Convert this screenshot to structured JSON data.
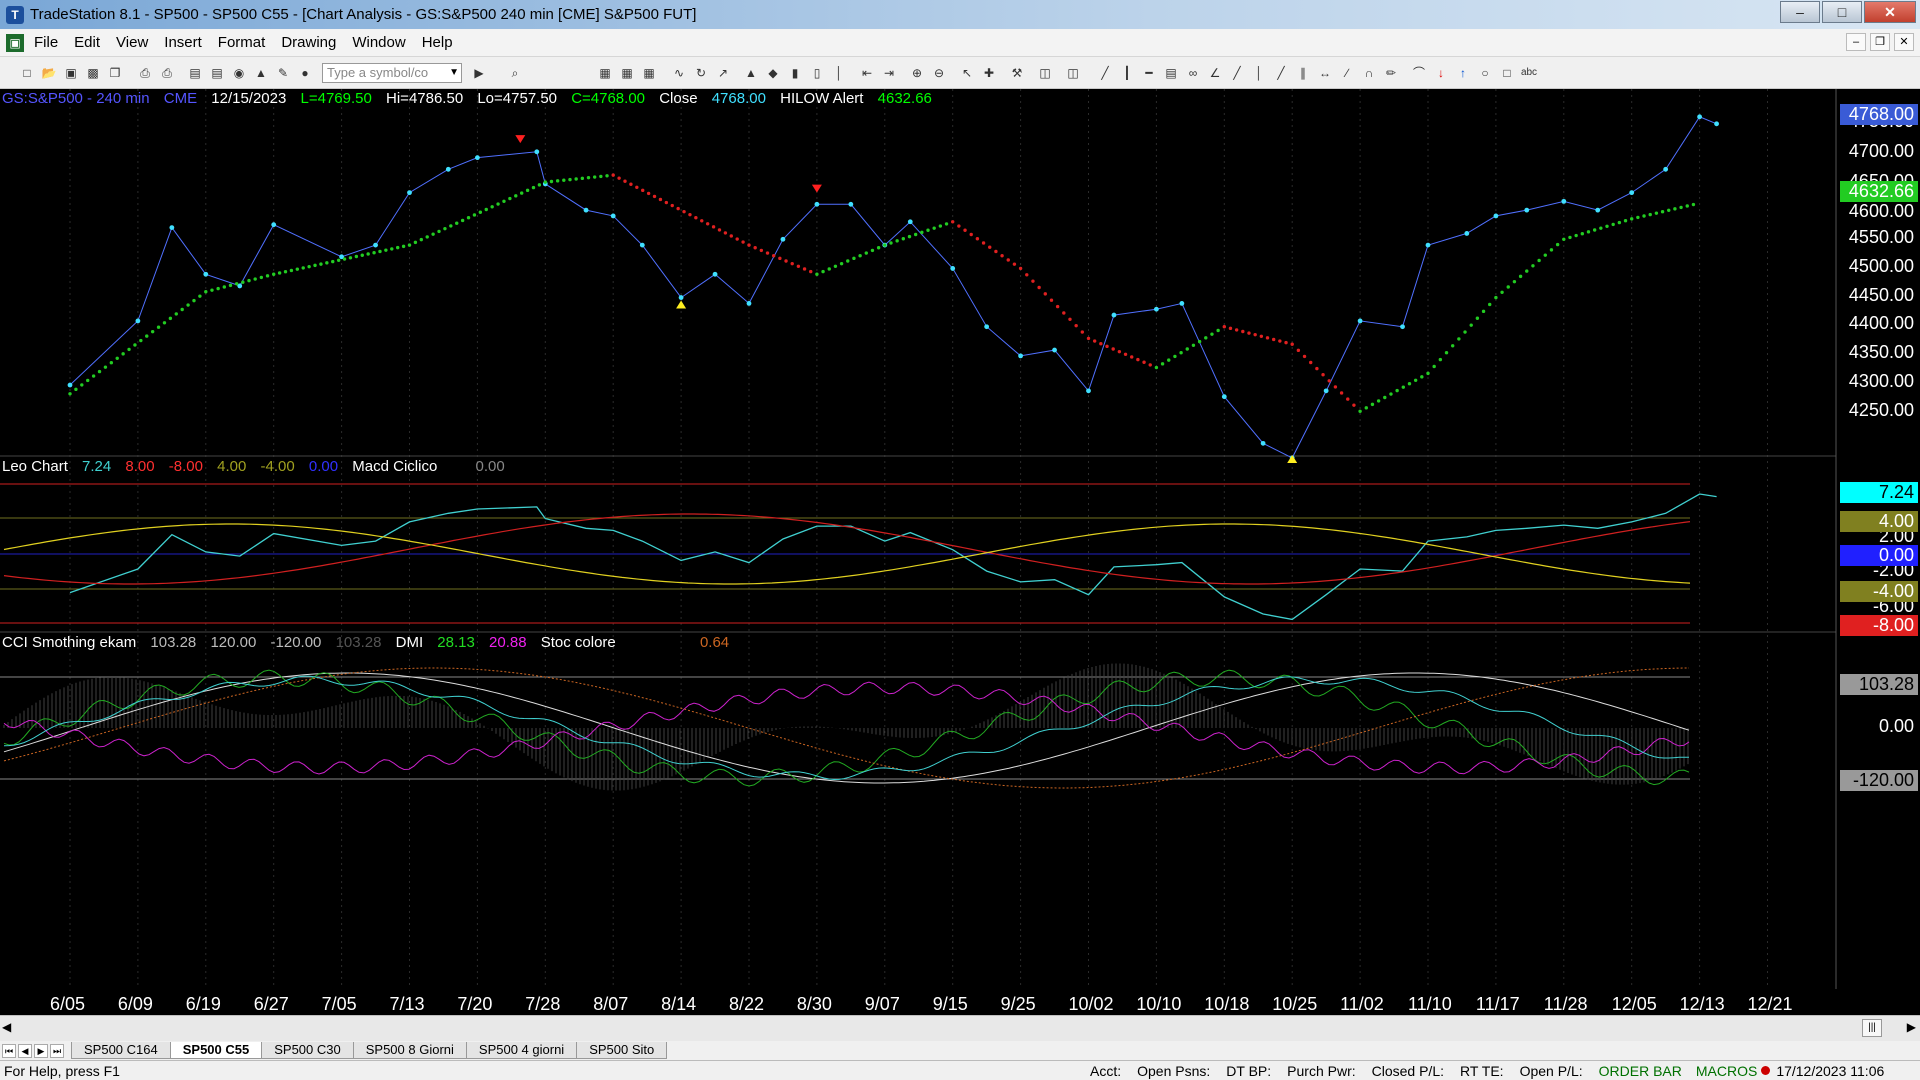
{
  "window": {
    "title": "TradeStation 8.1 - SP500 - SP500 C55 - [Chart Analysis - GS:S&P500  240 min  [CME] S&P500 FUT]"
  },
  "menu": [
    "File",
    "Edit",
    "View",
    "Insert",
    "Format",
    "Drawing",
    "Window",
    "Help"
  ],
  "toolbar": {
    "symbol_placeholder": "Type a symbol/co"
  },
  "price_panel": {
    "symbol": "GS:S&P500 - 240 min",
    "exchange": "CME",
    "date": "12/15/2023",
    "last": "L=4769.50",
    "high": "Hi=4786.50",
    "low": "Lo=4757.50",
    "close_c": "C=4768.00",
    "close_label": "Close",
    "close_value": "4768.00",
    "indicator": "HILOW Alert",
    "indicator_value": "4632.66",
    "axis_labels": [
      "4750.00",
      "4700.00",
      "4650.00",
      "4600.00",
      "4550.00",
      "4500.00",
      "4450.00",
      "4400.00",
      "4350.00",
      "4300.00",
      "4250.00"
    ],
    "last_price_tag": "4768.00",
    "hilow_tag": "4632.66"
  },
  "osc_panel": {
    "name": "Leo Chart",
    "v1": "7.24",
    "v2": "8.00",
    "v3": "-8.00",
    "v4": "4.00",
    "v5": "-4.00",
    "v6": "0.00",
    "name2": "Macd Ciclico",
    "v7": "0.00",
    "axis_labels": [
      "2.00",
      "-2.00",
      "-6.00"
    ],
    "tags": [
      "7.24",
      "4.00",
      "0.00",
      "-4.00",
      "-8.00"
    ]
  },
  "cci_panel": {
    "name": "CCI Smothing ekam",
    "v1": "103.28",
    "v2": "120.00",
    "v3": "-120.00",
    "v4": "103.28",
    "name2": "DMI",
    "v5": "28.13",
    "v6": "20.88",
    "name3": "Stoc colore",
    "v7": "0.64",
    "axis_labels": [
      "0.00"
    ],
    "tags": [
      "103.28",
      "-120.00"
    ]
  },
  "date_axis": [
    "6/05",
    "6/09",
    "6/19",
    "6/27",
    "7/05",
    "7/13",
    "7/20",
    "7/28",
    "8/07",
    "8/14",
    "8/22",
    "8/30",
    "9/07",
    "9/15",
    "9/25",
    "10/02",
    "10/10",
    "10/18",
    "10/25",
    "11/02",
    "11/10",
    "11/17",
    "11/28",
    "12/05",
    "12/13",
    "12/21"
  ],
  "tabs": [
    "SP500 C164",
    "SP500 C55",
    "SP500 C30",
    "SP500 8 Giorni",
    "SP500 4 giorni",
    "SP500 Sito"
  ],
  "active_tab": "SP500 C55",
  "status": {
    "help": "For Help, press F1",
    "acct": "Acct:",
    "open_psns": "Open Psns:",
    "dt_bp": "DT BP:",
    "purch_pwr": "Purch Pwr:",
    "closed_pl": "Closed P/L:",
    "rt_te": "RT TE:",
    "open_pl": "Open P/L:",
    "order_bar": "ORDER BAR",
    "macros": "MACROS",
    "datetime": "17/12/2023 11:06"
  },
  "colors": {
    "price_line": "#40e0ff",
    "hilow_up": "#22cc22",
    "hilow_down": "#e02020",
    "leo_line": "#40d0d0",
    "red_cycle": "#d02020",
    "yellow_cycle": "#e0d020",
    "cci_white": "#dddddd",
    "dmi_plus": "#22aa22",
    "dmi_minus": "#cc22cc",
    "stoc": "#cc6622"
  },
  "chart_data": {
    "type": "line",
    "price_series": [
      {
        "x": "6/05",
        "y": 4320
      },
      {
        "x": "6/09",
        "y": 4430
      },
      {
        "x": "6/14",
        "y": 4590
      },
      {
        "x": "6/19",
        "y": 4510
      },
      {
        "x": "6/23",
        "y": 4490
      },
      {
        "x": "6/27",
        "y": 4595
      },
      {
        "x": "7/05",
        "y": 4540
      },
      {
        "x": "7/09",
        "y": 4560
      },
      {
        "x": "7/13",
        "y": 4650
      },
      {
        "x": "7/17",
        "y": 4690
      },
      {
        "x": "7/20",
        "y": 4710
      },
      {
        "x": "7/27",
        "y": 4720
      },
      {
        "x": "7/28",
        "y": 4665
      },
      {
        "x": "8/03",
        "y": 4620
      },
      {
        "x": "8/07",
        "y": 4610
      },
      {
        "x": "8/10",
        "y": 4560
      },
      {
        "x": "8/14",
        "y": 4470
      },
      {
        "x": "8/18",
        "y": 4510
      },
      {
        "x": "8/22",
        "y": 4460
      },
      {
        "x": "8/26",
        "y": 4570
      },
      {
        "x": "8/30",
        "y": 4630
      },
      {
        "x": "9/03",
        "y": 4630
      },
      {
        "x": "9/07",
        "y": 4560
      },
      {
        "x": "9/10",
        "y": 4600
      },
      {
        "x": "9/15",
        "y": 4520
      },
      {
        "x": "9/20",
        "y": 4420
      },
      {
        "x": "9/25",
        "y": 4370
      },
      {
        "x": "9/29",
        "y": 4380
      },
      {
        "x": "10/02",
        "y": 4310
      },
      {
        "x": "10/05",
        "y": 4440
      },
      {
        "x": "10/10",
        "y": 4450
      },
      {
        "x": "10/13",
        "y": 4460
      },
      {
        "x": "10/18",
        "y": 4300
      },
      {
        "x": "10/22",
        "y": 4220
      },
      {
        "x": "10/25",
        "y": 4195
      },
      {
        "x": "10/29",
        "y": 4310
      },
      {
        "x": "11/02",
        "y": 4430
      },
      {
        "x": "11/07",
        "y": 4420
      },
      {
        "x": "11/10",
        "y": 4560
      },
      {
        "x": "11/14",
        "y": 4580
      },
      {
        "x": "11/17",
        "y": 4610
      },
      {
        "x": "11/22",
        "y": 4620
      },
      {
        "x": "11/28",
        "y": 4635
      },
      {
        "x": "12/01",
        "y": 4620
      },
      {
        "x": "12/05",
        "y": 4650
      },
      {
        "x": "12/09",
        "y": 4690
      },
      {
        "x": "12/13",
        "y": 4780
      },
      {
        "x": "12/15",
        "y": 4768
      }
    ],
    "hilow_series": [
      {
        "x": "6/05",
        "y": 4305
      },
      {
        "x": "6/19",
        "y": 4480
      },
      {
        "x": "6/27",
        "y": 4510
      },
      {
        "x": "7/13",
        "y": 4560
      },
      {
        "x": "7/28",
        "y": 4668
      },
      {
        "x": "8/07",
        "y": 4680
      },
      {
        "x": "8/22",
        "y": 4560
      },
      {
        "x": "8/30",
        "y": 4510
      },
      {
        "x": "9/07",
        "y": 4560
      },
      {
        "x": "9/15",
        "y": 4600
      },
      {
        "x": "9/25",
        "y": 4520
      },
      {
        "x": "10/02",
        "y": 4400
      },
      {
        "x": "10/10",
        "y": 4350
      },
      {
        "x": "10/18",
        "y": 4420
      },
      {
        "x": "10/25",
        "y": 4390
      },
      {
        "x": "11/02",
        "y": 4275
      },
      {
        "x": "11/10",
        "y": 4340
      },
      {
        "x": "11/17",
        "y": 4470
      },
      {
        "x": "11/28",
        "y": 4570
      },
      {
        "x": "12/05",
        "y": 4605
      },
      {
        "x": "12/13",
        "y": 4632
      }
    ],
    "ylim": [
      4200,
      4790
    ]
  }
}
